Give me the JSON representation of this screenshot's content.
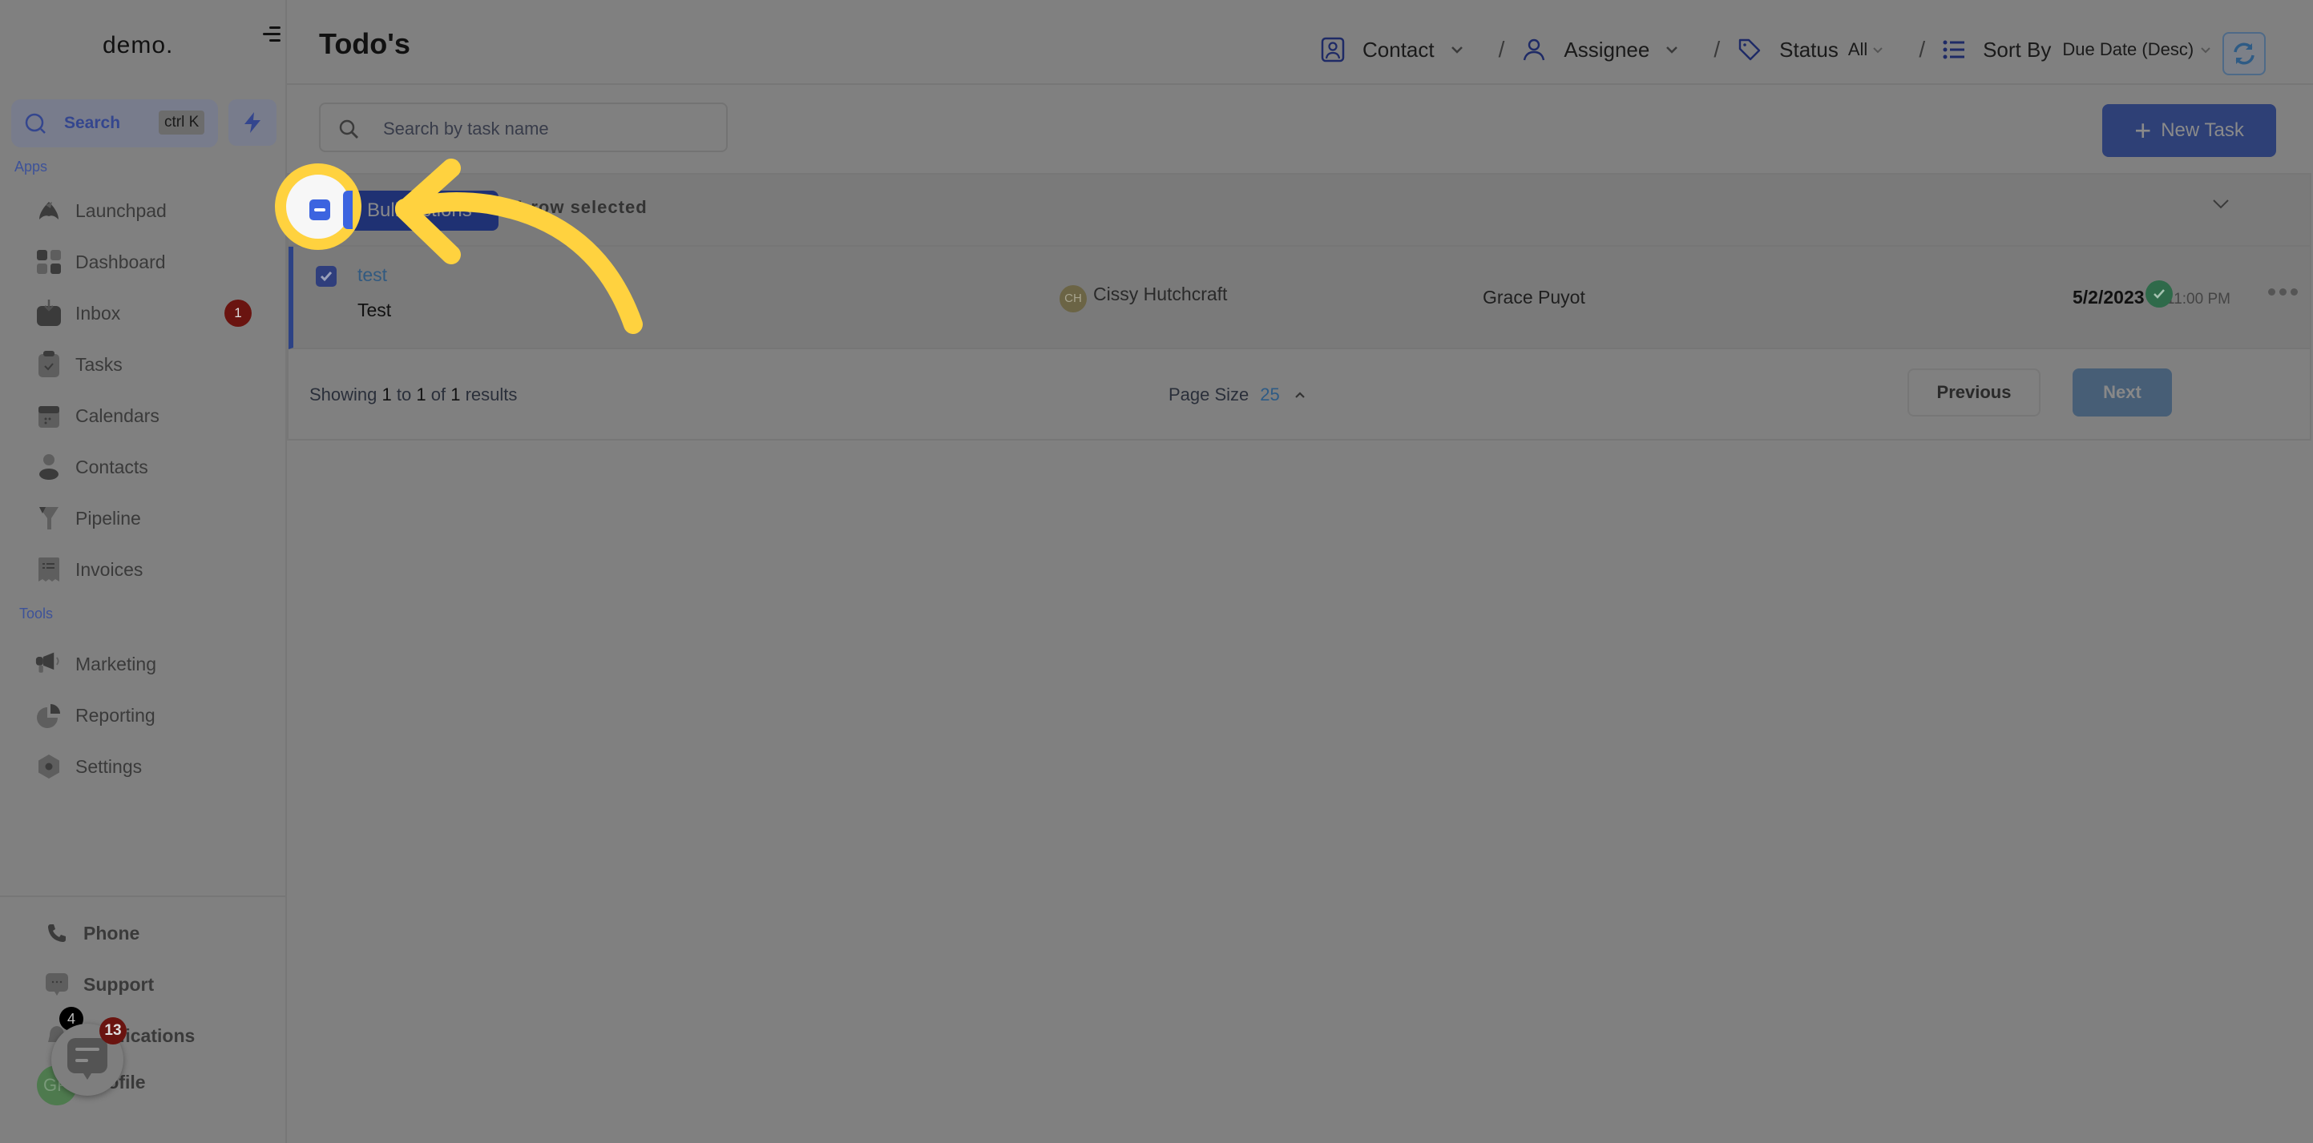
{
  "sidebar": {
    "logo": "demo.",
    "search": {
      "label": "Search",
      "shortcut": "ctrl K"
    },
    "apps_label": "Apps",
    "tools_label": "Tools",
    "apps": [
      {
        "label": "Launchpad",
        "icon": "rocket-icon"
      },
      {
        "label": "Dashboard",
        "icon": "grid-icon"
      },
      {
        "label": "Inbox",
        "icon": "inbox-icon",
        "badge": "1"
      },
      {
        "label": "Tasks",
        "icon": "clipboard-check-icon"
      },
      {
        "label": "Calendars",
        "icon": "calendar-icon"
      },
      {
        "label": "Contacts",
        "icon": "person-icon"
      },
      {
        "label": "Pipeline",
        "icon": "funnel-icon"
      },
      {
        "label": "Invoices",
        "icon": "receipt-icon"
      }
    ],
    "tools": [
      {
        "label": "Marketing",
        "icon": "megaphone-icon"
      },
      {
        "label": "Reporting",
        "icon": "pie-chart-icon"
      },
      {
        "label": "Settings",
        "icon": "hexagon-gear-icon"
      }
    ],
    "bottom": [
      {
        "label": "Phone",
        "icon": "phone-icon"
      },
      {
        "label": "Support",
        "icon": "chat-bubble-icon"
      },
      {
        "label": "Notifications",
        "icon": "bell-icon",
        "badge": "4"
      },
      {
        "label": "Profile",
        "avatar": "GP"
      }
    ],
    "chat_widget_badge": "13"
  },
  "header": {
    "title": "Todo's",
    "filters": {
      "contact": "Contact",
      "assignee": "Assignee",
      "status": "Status",
      "status_value": "All",
      "sort_by": "Sort By",
      "sort_value": "Due Date (Desc)"
    },
    "separator": "/"
  },
  "toolbar": {
    "search_placeholder": "Search by task name",
    "new_task_label": "New Task"
  },
  "table": {
    "bulk_actions_label": "Bulk Actions",
    "selection_text": "1 row selected",
    "rows": [
      {
        "title": "test",
        "description": "Test",
        "contact_initials": "CH",
        "contact": "Cissy Hutchcraft",
        "assignee": "Grace Puyot",
        "due_date": "5/2/2023",
        "due_time": "at 11:00 PM",
        "selected": true,
        "completed": true
      }
    ],
    "footer": {
      "showing_prefix": "Showing",
      "from": "1",
      "to_word": "to",
      "to": "1",
      "of_word": "of",
      "total": "1",
      "results_word": "results",
      "page_size_label": "Page Size",
      "page_size": "25",
      "previous_label": "Previous",
      "next_label": "Next"
    }
  },
  "colors": {
    "accent": "#3c64e0",
    "highlight": "#ffd23f",
    "overlay": "#808080"
  }
}
